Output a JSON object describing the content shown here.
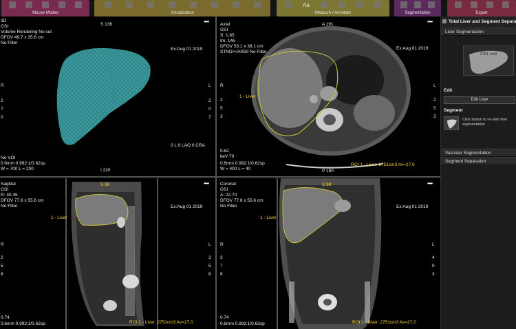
{
  "toolbar": {
    "groups": [
      {
        "label": "Mouse Modes",
        "color": "#7a2a4e"
      },
      {
        "label": "Visualization",
        "color": "#7a6a2e"
      },
      {
        "label": "Measure / Annotate",
        "color": "#7b7733"
      },
      {
        "label": "Segmentation",
        "color": "#5b2a5e"
      },
      {
        "label": "Export",
        "color": "#7a2a3e"
      }
    ],
    "measure_text_icon": "Aa"
  },
  "viewports": {
    "vr": {
      "title": "3D",
      "line2": "GSI",
      "line3": "Volume Rendering No cut",
      "line4": "DFOV 49.7 x 35.6 cm",
      "line5": "No Filter",
      "top_marker": "S 136",
      "bottom_marker": "I 220",
      "date": "Ex:Aug 01 2019",
      "orient_left": "R",
      "orient_right": "L",
      "left_nums": [
        "2",
        "7",
        "0"
      ],
      "right_nums": [
        "2",
        "0",
        "7"
      ],
      "voi": "No VOI",
      "thickness": "0.6mm 0.992:1/0.62sp",
      "window": "W = 700 L = 200",
      "angle": "0 L 0 LAO 0 CRA",
      "dots": "••••"
    },
    "axial": {
      "title": "Axial",
      "line2": "GSI",
      "line3": "S: 1.85",
      "line4": "Im: 146",
      "line5": "DFOV 53.1 x 38.1 cm",
      "line6": "STND/+/AR50 No Filter",
      "top_marker": "A 191",
      "bottom_marker": "P 190",
      "date": "Ex:Aug 01 2019",
      "orient_left": "R",
      "orient_right": "L",
      "left_nums": [
        "2",
        "5",
        "3"
      ],
      "right_nums": [
        "2",
        "5",
        "3"
      ],
      "liver_label": "1 - Liver",
      "kv": "0.62",
      "kev": "keV 70",
      "thickness": "0.6mm 0.992:1/0.62sp",
      "window": "W = 400 L = 40",
      "roi": "ROI 1 - Liver: 2751cm3 Av=27.0",
      "dots": "••••"
    },
    "sagittal": {
      "title": "Sagittal",
      "line2": "GSI",
      "line3": "R: 30.35",
      "line4": "DFOV 77.6 x 55.6 cm",
      "line5": "No Filter",
      "top_marker": "S 99",
      "date": "Ex:Aug 01 2019",
      "orient_left": "R",
      "orient_right": "L",
      "left_nums": [
        "2",
        "5",
        "8"
      ],
      "right_nums": [
        "3",
        "5",
        "8"
      ],
      "liver_label": "1 - Liver",
      "kv": "0.74",
      "thickness": "0.6mm 0.992:1/0.62sp",
      "roi": "ROI 1 - Liver: 2751cm3 Av=27.0",
      "dots": "••••"
    },
    "coronal": {
      "title": "Coronal",
      "line2": "GSI",
      "line3": "A: 22.70",
      "line4": "DFOV 77.6 x 55.6 cm",
      "line5": "No Filter",
      "top_marker": "S 99",
      "date": "Ex:Aug 01 2019",
      "orient_left": "R",
      "orient_right": "L",
      "left_nums": [
        "3",
        "7",
        "8"
      ],
      "right_nums": [
        "4",
        "0",
        "3"
      ],
      "liver_label": "1 - Liver",
      "kv": "0.74",
      "thickness": "0.6mm 0.992:1/0.62sp",
      "roi": "ROI 1 - Liver: 2751cm3 Av=27.0",
      "dots": "••••"
    }
  },
  "panel": {
    "title": "Total Liver and Segment Separation",
    "liver_segmentation": "Liver Segmentation",
    "thumb_label": "2751 cm3",
    "edit_heading": "Edit",
    "edit_button": "Edit Liver",
    "segment_heading": "Segment",
    "segment_help": "Click button to re-start liver segmentation",
    "vascular": "Vascular Segmentation",
    "segment_separation": "Segment Separation"
  },
  "colors": {
    "liver_vr": "#3fb6b8",
    "contour": "#c9c23a",
    "overlay_text": "#f0f0f0",
    "panel_bg": "#1c1c1c"
  }
}
